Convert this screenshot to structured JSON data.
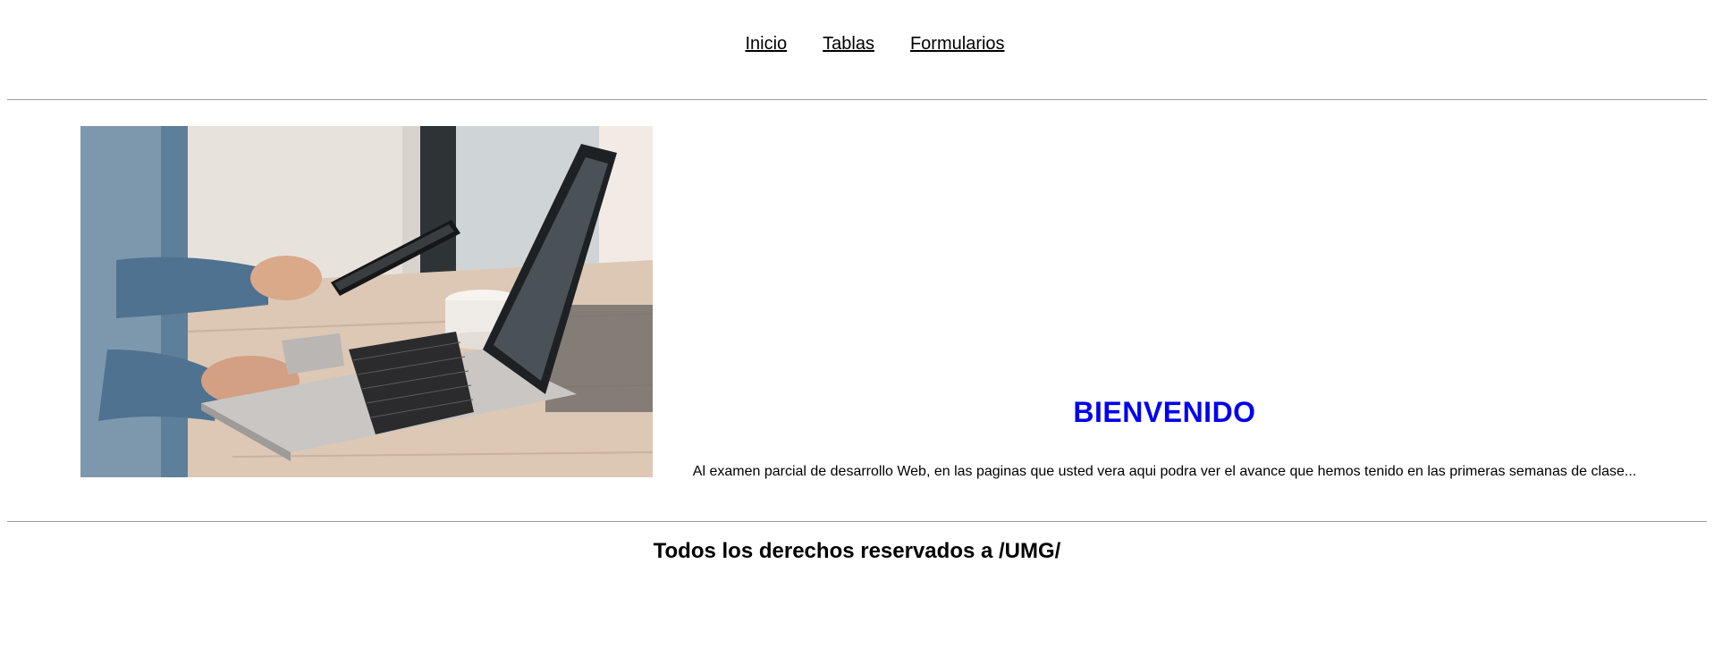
{
  "nav": {
    "items": [
      {
        "label": "Inicio"
      },
      {
        "label": "Tablas"
      },
      {
        "label": "Formularios"
      }
    ]
  },
  "hero": {
    "image_subject": "hands-using-phone-and-laptop-photo"
  },
  "welcome": {
    "title": "BIENVENIDO",
    "text": "Al examen parcial de desarrollo Web, en las paginas que usted vera aqui podra ver el avance que hemos tenido en las primeras semanas de clase..."
  },
  "footer": {
    "text": "Todos los derechos reservados a /UMG/"
  },
  "colors": {
    "title": "#0000ee",
    "rule": "#9a9a9a",
    "background": "#ffffff"
  }
}
